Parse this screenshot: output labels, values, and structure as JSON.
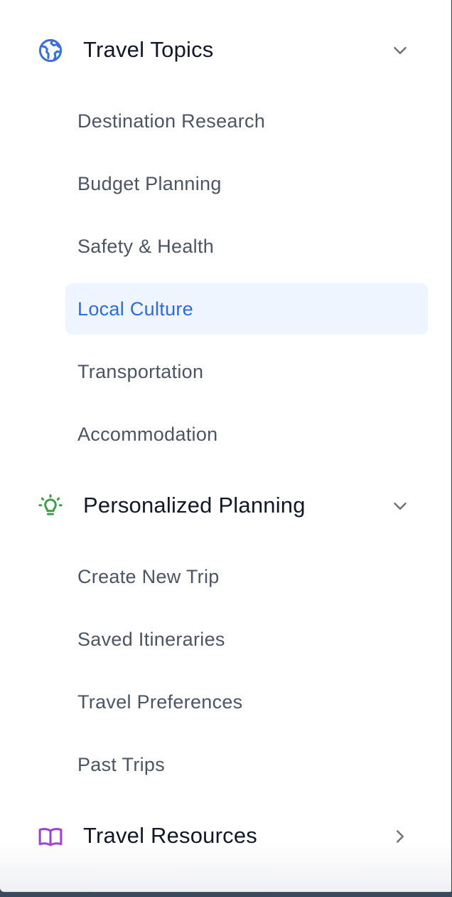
{
  "sections": [
    {
      "title": "Travel Topics",
      "icon": "globe-icon",
      "icon_color": "#3b6fe0",
      "expanded": true,
      "items": [
        {
          "label": "Destination Research",
          "active": false
        },
        {
          "label": "Budget Planning",
          "active": false
        },
        {
          "label": "Safety & Health",
          "active": false
        },
        {
          "label": "Local Culture",
          "active": true
        },
        {
          "label": "Transportation",
          "active": false
        },
        {
          "label": "Accommodation",
          "active": false
        }
      ]
    },
    {
      "title": "Personalized Planning",
      "icon": "lightbulb-icon",
      "icon_color": "#3f9d4c",
      "expanded": true,
      "items": [
        {
          "label": "Create New Trip",
          "active": false
        },
        {
          "label": "Saved Itineraries",
          "active": false
        },
        {
          "label": "Travel Preferences",
          "active": false
        },
        {
          "label": "Past Trips",
          "active": false
        }
      ]
    },
    {
      "title": "Travel Resources",
      "icon": "book-open-icon",
      "icon_color": "#9b3fd6",
      "expanded": false,
      "items": []
    }
  ],
  "colors": {
    "active_text": "#2f6ae0",
    "active_background": "#eff5fe",
    "item_text": "#4b5563",
    "header_text": "#111827",
    "chevron": "#6b7280"
  }
}
